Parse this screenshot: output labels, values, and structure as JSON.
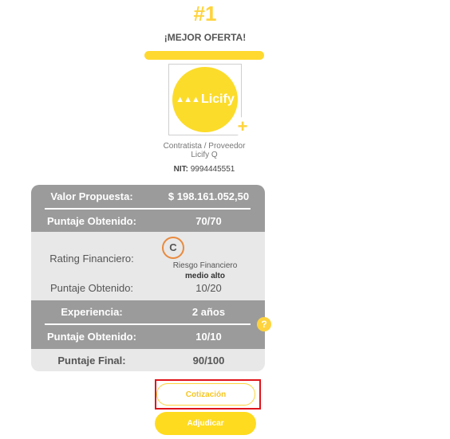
{
  "header": {
    "rank": "#1",
    "tag": "¡MEJOR OFERTA!"
  },
  "logo": {
    "brand": "Licify",
    "mark": "▲▲▲"
  },
  "provider": {
    "role": "Contratista / Proveedor",
    "name": "Licify Q",
    "nit_label": "NIT:",
    "nit_value": "9994445551"
  },
  "summary": {
    "valor_label": "Valor Propuesta:",
    "valor_value": "$ 198.161.052,50",
    "puntaje1_label": "Puntaje Obtenido:",
    "puntaje1_value": "70/70",
    "rating_label": "Rating Financiero:",
    "rating_grade": "C",
    "risk_label": "Riesgo Financiero",
    "risk_value": "medio alto",
    "puntaje2_label": "Puntaje Obtenido:",
    "puntaje2_value": "10/20",
    "experiencia_label": "Experiencia:",
    "experiencia_value": "2 años",
    "puntaje3_label": "Puntaje Obtenido:",
    "puntaje3_value": "10/10",
    "final_label": "Puntaje Final:",
    "final_value": "90/100"
  },
  "help_symbol": "?",
  "actions": {
    "cotizacion": "Cotización",
    "adjudicar": "Adjudicar"
  },
  "colors": {
    "accent": "#ffd33d",
    "dark_row": "#9b9b9b",
    "light_row": "#e8e8e8",
    "highlight": "#e0141b"
  }
}
